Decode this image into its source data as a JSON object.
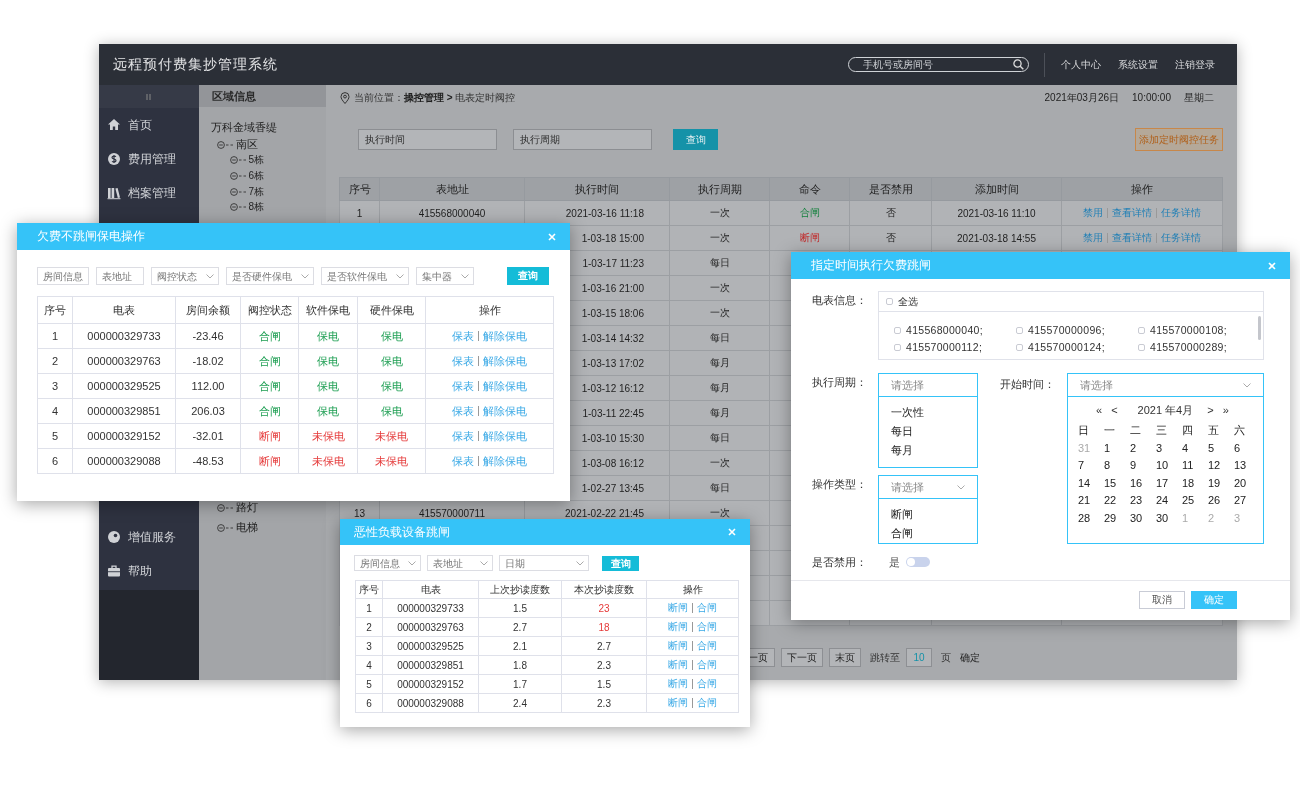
{
  "header": {
    "title": "远程预付费集抄管理系统",
    "search_placeholder": "手机号或房间号",
    "links": [
      "个人中心",
      "系统设置",
      "注销登录"
    ]
  },
  "sidebar": {
    "top_items": [
      {
        "label": "首页"
      },
      {
        "label": "费用管理"
      },
      {
        "label": "档案管理"
      }
    ],
    "bottom_items": [
      {
        "label": "增值服务"
      },
      {
        "label": "帮助"
      }
    ]
  },
  "region_panel": {
    "title": "区域信息",
    "tree": {
      "label": "万科金域香缇",
      "children": [
        {
          "label": "南区",
          "children": [
            {
              "label": "5栋"
            },
            {
              "label": "6栋"
            },
            {
              "label": "7栋"
            },
            {
              "label": "8栋"
            }
          ]
        },
        {
          "label": "路灯"
        },
        {
          "label": "电梯"
        }
      ]
    }
  },
  "breadcrumb": "当前位置：**操控管理 >** 电表定时阀控",
  "datetime": [
    "2021年03月26日",
    "10:00:00",
    "星期二"
  ],
  "filters": {
    "fields": [
      {
        "placeholder": "执行时间"
      },
      {
        "placeholder": "执行周期"
      }
    ],
    "search_button": "查询",
    "add_button": "添加定时阀控任务"
  },
  "task_table": {
    "columns": [
      "序号",
      "表地址",
      "执行时间",
      "执行周期",
      "命令",
      "是否禁用",
      "添加时间",
      "操作"
    ],
    "rows": [
      {
        "no": "1",
        "address": "415568000040",
        "time": "2021-03-16 11:18",
        "period": "一次",
        "command": {
          "text": "合闸",
          "on": true
        },
        "disabled": "否",
        "added": "2021-03-16 11:10",
        "actions": [
          "禁用",
          "查看详情",
          "任务详情"
        ]
      },
      {
        "time": "1-03-18 15:00",
        "period": "一次",
        "command": {
          "text": "断闸",
          "on": false
        },
        "disabled": "否",
        "added": "2021-03-18 14:55",
        "actions": [
          "禁用",
          "查看详情",
          "任务详情"
        ]
      },
      {
        "time": "1-03-17 11:23",
        "period": "每日"
      },
      {
        "time": "1-03-16 21:00",
        "period": "一次"
      },
      {
        "time": "1-03-15 18:06",
        "period": "一次"
      },
      {
        "time": "1-03-14 14:32",
        "period": "每日"
      },
      {
        "time": "1-03-13 17:02",
        "period": "每月"
      },
      {
        "time": "1-03-12 16:12",
        "period": "每月"
      },
      {
        "time": "1-03-11 22:45",
        "period": "每月"
      },
      {
        "time": "1-03-10 15:30",
        "period": "每日"
      },
      {
        "time": "1-03-08 16:12",
        "period": "一次"
      },
      {
        "time": "1-02-27 13:45",
        "period": "每日"
      },
      {
        "no": "13",
        "address": "415570000711",
        "time": "2021-02-22 21:45",
        "period": "一次"
      }
    ]
  },
  "pagination": {
    "buttons": [
      "一页",
      "下一页",
      "末页"
    ],
    "jump_label": "跳转至",
    "page_value": "10",
    "page_unit": "页",
    "confirm": "确定"
  },
  "protect_dialog": {
    "title": "欠费不跳闸保电操作",
    "filters": [
      {
        "placeholder": "房间信息",
        "dropdown": false
      },
      {
        "placeholder": "表地址",
        "dropdown": false
      },
      {
        "placeholder": "阀控状态",
        "dropdown": true
      },
      {
        "placeholder": "是否硬件保电",
        "dropdown": true
      },
      {
        "placeholder": "是否软件保电",
        "dropdown": true
      },
      {
        "placeholder": "集中器",
        "dropdown": true
      }
    ],
    "search_button": "查询",
    "columns": [
      "序号",
      "电表",
      "房间余额",
      "阀控状态",
      "软件保电",
      "硬件保电",
      "操作"
    ],
    "rows": [
      {
        "no": "1",
        "meter": "000000329733",
        "balance": "-23.46",
        "valve": {
          "text": "合闸",
          "on": true
        },
        "soft": {
          "text": "保电",
          "on": true
        },
        "hard": {
          "text": "保电",
          "on": true
        },
        "actions": [
          "保表",
          "解除保电"
        ]
      },
      {
        "no": "2",
        "meter": "000000329763",
        "balance": "-18.02",
        "valve": {
          "text": "合闸",
          "on": true
        },
        "soft": {
          "text": "保电",
          "on": true
        },
        "hard": {
          "text": "保电",
          "on": true
        },
        "actions": [
          "保表",
          "解除保电"
        ]
      },
      {
        "no": "3",
        "meter": "000000329525",
        "balance": "112.00",
        "valve": {
          "text": "合闸",
          "on": true
        },
        "soft": {
          "text": "保电",
          "on": true
        },
        "hard": {
          "text": "保电",
          "on": true
        },
        "actions": [
          "保表",
          "解除保电"
        ]
      },
      {
        "no": "4",
        "meter": "000000329851",
        "balance": "206.03",
        "valve": {
          "text": "合闸",
          "on": true
        },
        "soft": {
          "text": "保电",
          "on": true
        },
        "hard": {
          "text": "保电",
          "on": true
        },
        "actions": [
          "保表",
          "解除保电"
        ]
      },
      {
        "no": "5",
        "meter": "000000329152",
        "balance": "-32.01",
        "valve": {
          "text": "断闸",
          "on": false
        },
        "soft": {
          "text": "未保电",
          "on": false
        },
        "hard": {
          "text": "未保电",
          "on": false
        },
        "actions": [
          "保表",
          "解除保电"
        ]
      },
      {
        "no": "6",
        "meter": "000000329088",
        "balance": "-48.53",
        "valve": {
          "text": "断闸",
          "on": false
        },
        "soft": {
          "text": "未保电",
          "on": false
        },
        "hard": {
          "text": "未保电",
          "on": false
        },
        "actions": [
          "保表",
          "解除保电"
        ]
      }
    ]
  },
  "schedule_dialog": {
    "title": "指定时间执行欠费跳闸",
    "meter_label": "电表信息：",
    "select_all": {
      "label": "全选",
      "checked": false
    },
    "meters": [
      {
        "label": "415568000040;",
        "checked": false
      },
      {
        "label": "415570000096;",
        "checked": false
      },
      {
        "label": "415570000108;",
        "checked": false
      },
      {
        "label": "415570000112;",
        "checked": false
      },
      {
        "label": "415570000124;",
        "checked": false
      },
      {
        "label": "415570000289;",
        "checked": false
      }
    ],
    "period_label": "执行周期：",
    "period_select": {
      "placeholder": "请选择",
      "options": [
        "一次性",
        "每日",
        "每月"
      ]
    },
    "start_label": "开始时间：",
    "start_select": {
      "placeholder": "请选择"
    },
    "calendar": {
      "nav_prev": [
        "«",
        "<"
      ],
      "month": "2021 年4月",
      "nav_next": [
        ">",
        "»"
      ],
      "weekdays": [
        "日",
        "一",
        "二",
        "三",
        "四",
        "五",
        "六"
      ],
      "days": [
        {
          "d": "31",
          "other": true
        },
        {
          "d": "1",
          "other": false
        },
        {
          "d": "2",
          "other": false
        },
        {
          "d": "3",
          "other": false
        },
        {
          "d": "4",
          "other": false
        },
        {
          "d": "5",
          "other": false
        },
        {
          "d": "6",
          "other": false
        },
        {
          "d": "7",
          "other": false
        },
        {
          "d": "8",
          "other": false
        },
        {
          "d": "9",
          "other": false
        },
        {
          "d": "10",
          "other": false
        },
        {
          "d": "11",
          "other": false
        },
        {
          "d": "12",
          "other": false
        },
        {
          "d": "13",
          "other": false
        },
        {
          "d": "14",
          "other": false
        },
        {
          "d": "15",
          "other": false
        },
        {
          "d": "16",
          "other": false
        },
        {
          "d": "17",
          "other": false
        },
        {
          "d": "18",
          "other": false
        },
        {
          "d": "19",
          "other": false
        },
        {
          "d": "20",
          "other": false
        },
        {
          "d": "21",
          "other": false
        },
        {
          "d": "22",
          "other": false
        },
        {
          "d": "23",
          "other": false
        },
        {
          "d": "24",
          "other": false
        },
        {
          "d": "25",
          "other": false
        },
        {
          "d": "26",
          "other": false
        },
        {
          "d": "27",
          "other": false
        },
        {
          "d": "28",
          "other": false
        },
        {
          "d": "29",
          "other": false
        },
        {
          "d": "30",
          "other": false
        },
        {
          "d": "30",
          "other": false
        },
        {
          "d": "1",
          "other": true
        },
        {
          "d": "2",
          "other": true
        },
        {
          "d": "3",
          "other": true
        }
      ]
    },
    "type_label": "操作类型：",
    "type_select": {
      "placeholder": "请选择",
      "options": [
        "断闸",
        "合闸"
      ]
    },
    "disable_label": "是否禁用：",
    "disable_toggle": {
      "label": "是",
      "on": false
    },
    "buttons": [
      {
        "label": "取消",
        "kind": "secondary"
      },
      {
        "label": "确定",
        "kind": "primary"
      }
    ]
  },
  "overload_dialog": {
    "title": "恶性负载设备跳闸",
    "filters": [
      {
        "placeholder": "房间信息"
      },
      {
        "placeholder": "表地址"
      },
      {
        "placeholder": "日期"
      }
    ],
    "search_button": "查询",
    "columns": [
      "序号",
      "电表",
      "上次抄读度数",
      "本次抄读度数",
      "操作"
    ],
    "rows": [
      {
        "no": "1",
        "meter": "000000329733",
        "last": "1.5",
        "current": {
          "text": "23",
          "alert": true
        },
        "actions": [
          "断闸",
          "合闸"
        ]
      },
      {
        "no": "2",
        "meter": "000000329763",
        "last": "2.7",
        "current": {
          "text": "18",
          "alert": true
        },
        "actions": [
          "断闸",
          "合闸"
        ]
      },
      {
        "no": "3",
        "meter": "000000329525",
        "last": "2.1",
        "current": {
          "text": "2.7",
          "alert": false
        },
        "actions": [
          "断闸",
          "合闸"
        ]
      },
      {
        "no": "4",
        "meter": "000000329851",
        "last": "1.8",
        "current": {
          "text": "2.3",
          "alert": false
        },
        "actions": [
          "断闸",
          "合闸"
        ]
      },
      {
        "no": "5",
        "meter": "000000329152",
        "last": "1.7",
        "current": {
          "text": "1.5",
          "alert": false
        },
        "actions": [
          "断闸",
          "合闸"
        ]
      },
      {
        "no": "6",
        "meter": "000000329088",
        "last": "2.4",
        "current": {
          "text": "2.3",
          "alert": false
        },
        "actions": [
          "断闸",
          "合闸"
        ]
      }
    ]
  }
}
